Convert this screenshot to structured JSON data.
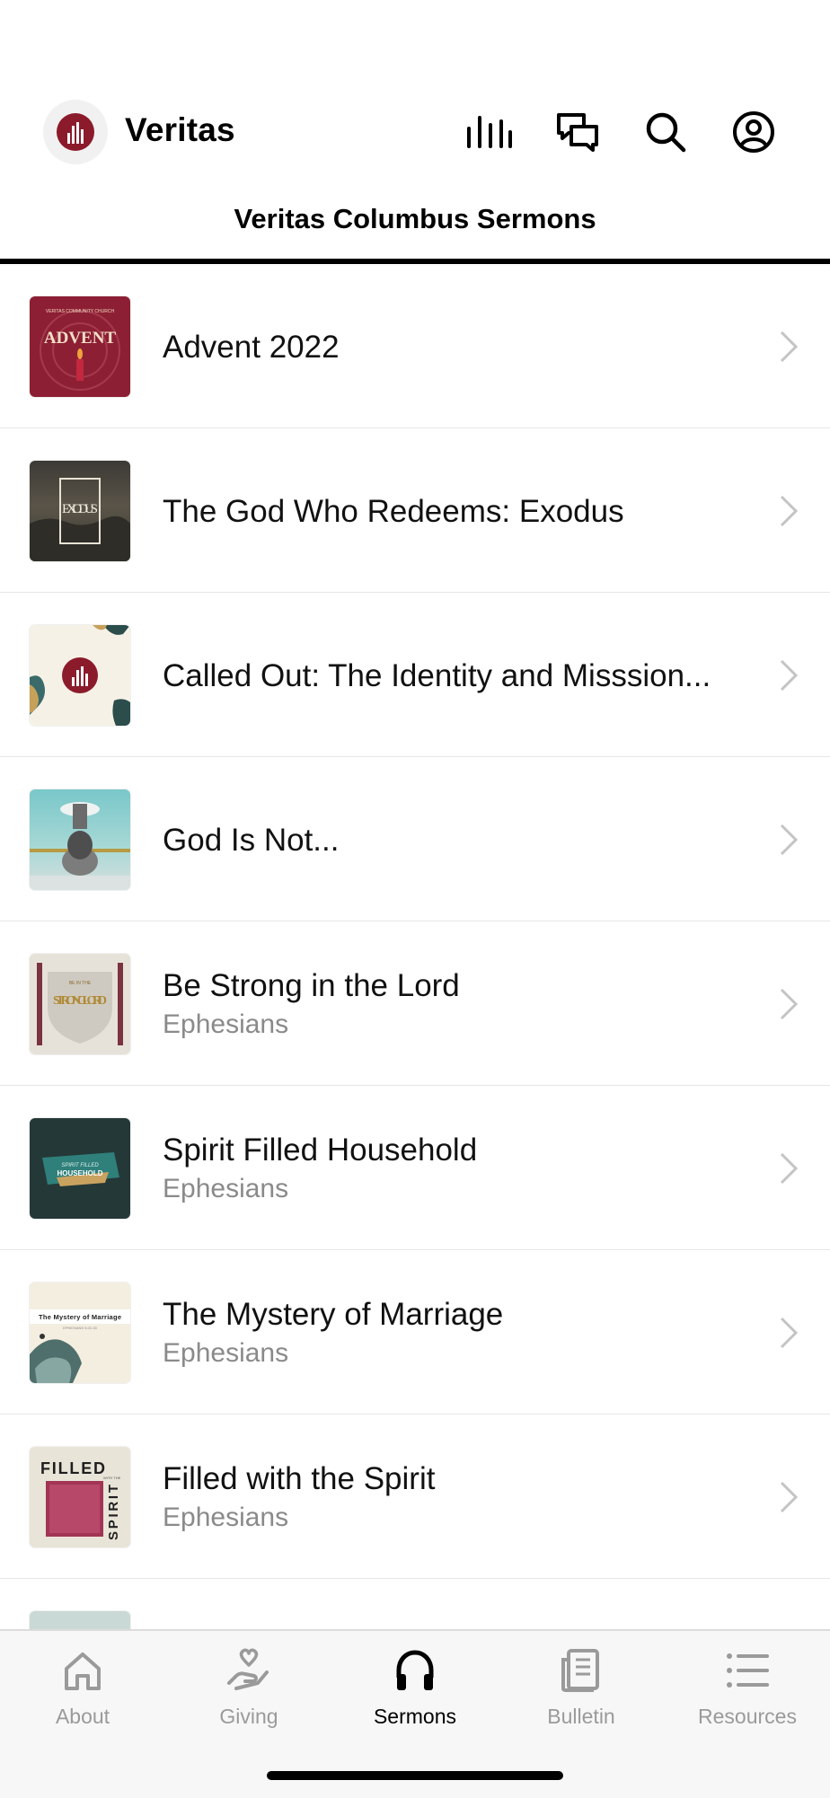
{
  "header": {
    "app_name": "Veritas",
    "section_title": "Veritas Columbus Sermons",
    "icons": [
      "stats-icon",
      "chat-icon",
      "search-icon",
      "profile-icon"
    ]
  },
  "sermons": [
    {
      "title": "Advent 2022",
      "subtitle": "",
      "thumb_text": "ADVENT",
      "thumb_caption": "VERITAS COMMUNITY CHURCH"
    },
    {
      "title": "The God Who Redeems: Exodus",
      "subtitle": "",
      "thumb_text": "EX OD US"
    },
    {
      "title": "Called Out: The Identity and Misssion...",
      "subtitle": ""
    },
    {
      "title": "God Is Not...",
      "subtitle": ""
    },
    {
      "title": "Be Strong in the Lord",
      "subtitle": "Ephesians",
      "thumb_text": "STRONG LORD",
      "thumb_small": "BE IN THE"
    },
    {
      "title": "Spirit Filled Household",
      "subtitle": "Ephesians",
      "thumb_text": "HOUSEHOLD",
      "thumb_small": "SPIRIT FILLED"
    },
    {
      "title": "The Mystery of Marriage",
      "subtitle": "Ephesians",
      "thumb_text": "The Mystery of Marriage",
      "thumb_small": "EPHESIANS 5:22-33"
    },
    {
      "title": "Filled with the Spirit",
      "subtitle": "Ephesians",
      "thumb_text": "FILLED",
      "thumb_side": "SPIRIT",
      "thumb_small": "WITH THE"
    }
  ],
  "tabbar": {
    "tabs": [
      {
        "label": "About",
        "icon": "home-icon"
      },
      {
        "label": "Giving",
        "icon": "giving-icon"
      },
      {
        "label": "Sermons",
        "icon": "headphones-icon",
        "active": true
      },
      {
        "label": "Bulletin",
        "icon": "bulletin-icon"
      },
      {
        "label": "Resources",
        "icon": "list-icon"
      }
    ]
  },
  "colors": {
    "accent": "#8b1a2b",
    "inactive_tab": "#9a9a9a",
    "subtitle": "#8a8a8a"
  }
}
